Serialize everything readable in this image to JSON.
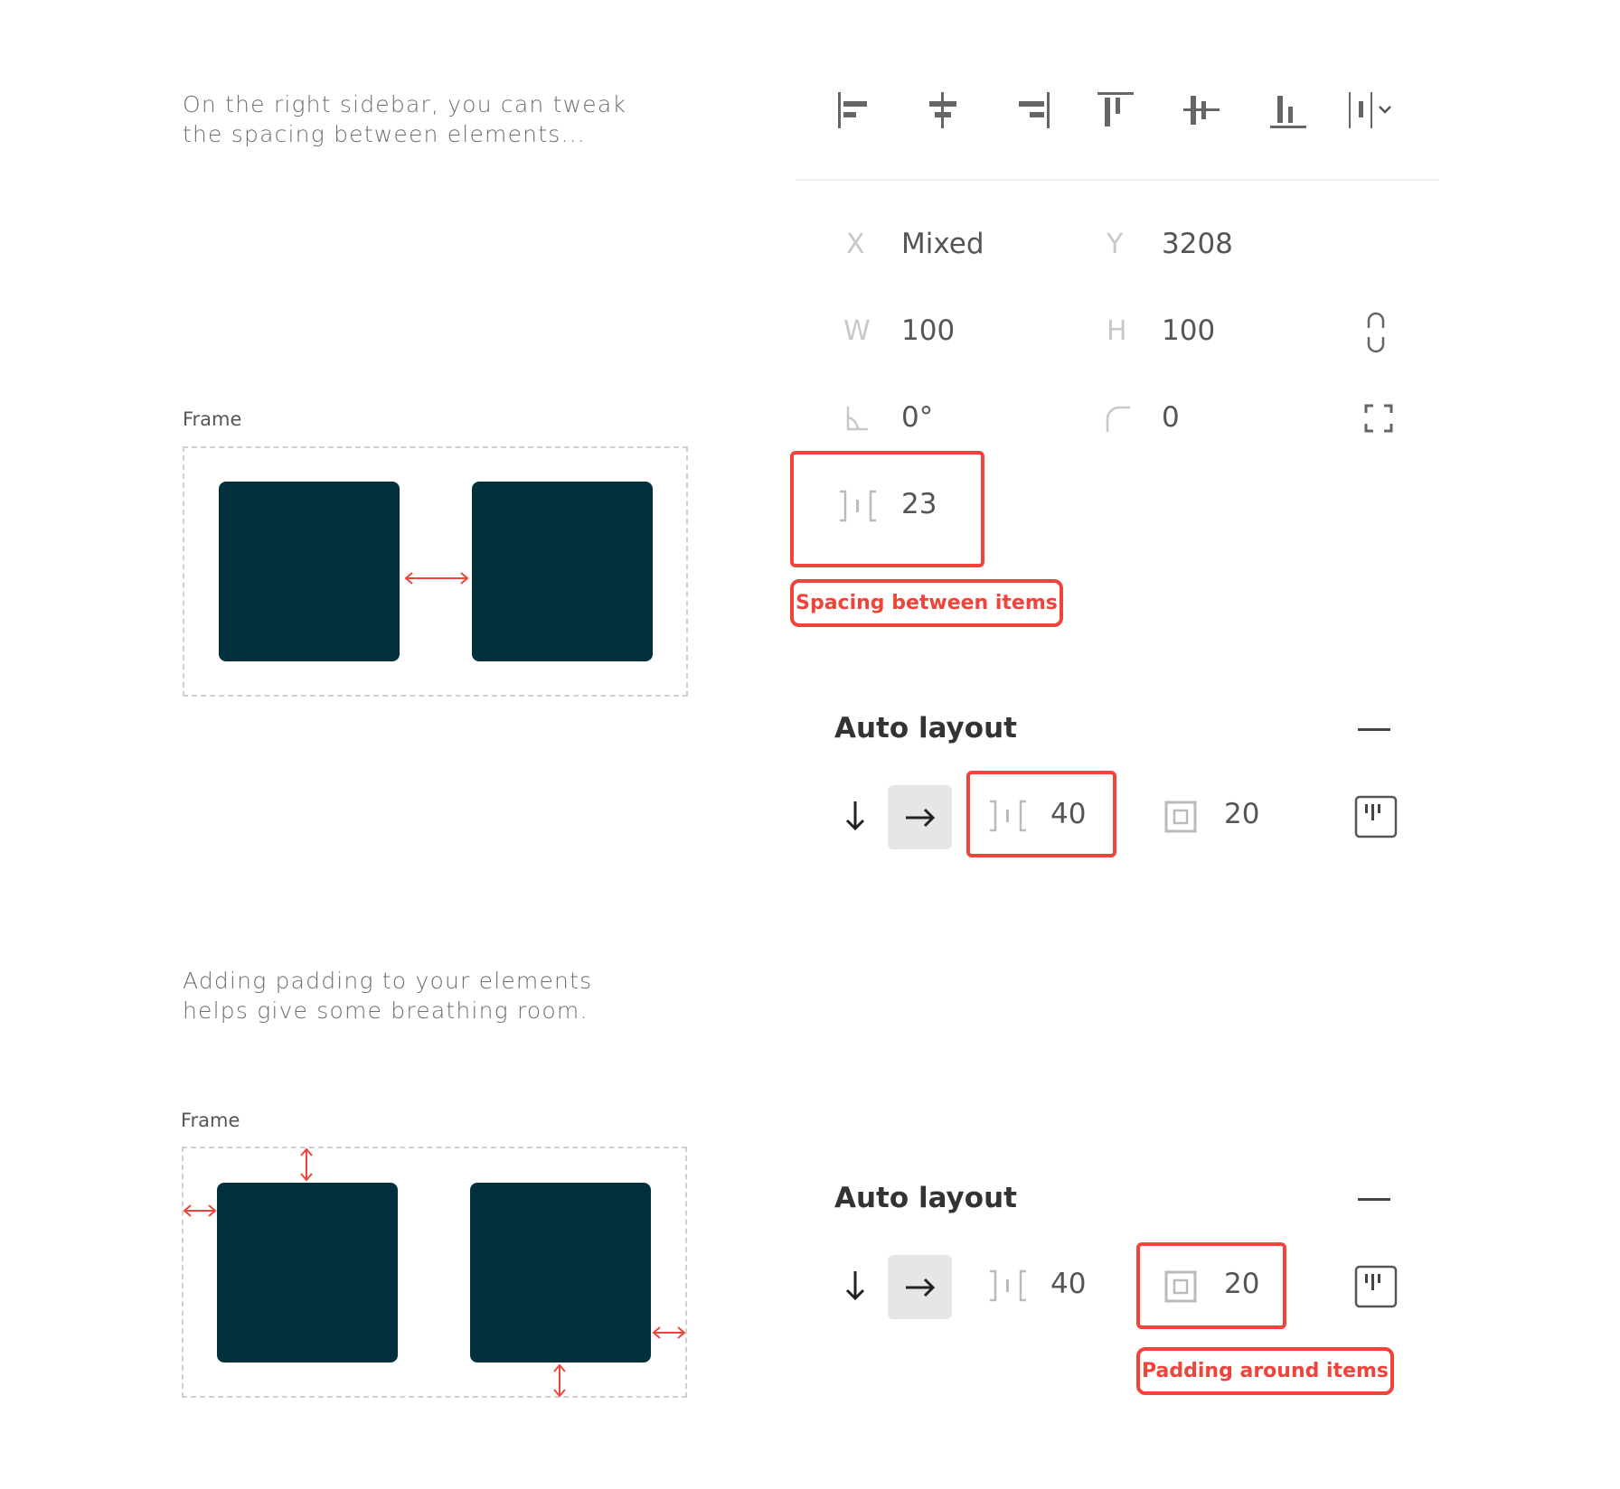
{
  "intro1": {
    "line1": "On the right sidebar, you can tweak",
    "line2": "the spacing between elements..."
  },
  "intro2": {
    "line1": "Adding padding to your elements",
    "line2": "helps give some breathing room."
  },
  "frame1": {
    "label": "Frame"
  },
  "frame2": {
    "label": "Frame"
  },
  "align_toolbar": {
    "icons": [
      "align-left-icon",
      "align-horizontal-center-icon",
      "align-right-icon",
      "align-top-icon",
      "align-vertical-center-icon",
      "align-bottom-icon",
      "distribute-dropdown-icon"
    ]
  },
  "properties": {
    "x_label": "X",
    "x_value": "Mixed",
    "y_label": "Y",
    "y_value": "3208",
    "w_label": "W",
    "w_value": "100",
    "h_label": "H",
    "h_value": "100",
    "rotation_value": "0°",
    "radius_value": "0",
    "spacing_value": "23"
  },
  "annotations": {
    "spacing": "Spacing between items",
    "padding": "Padding around items"
  },
  "auto_layout_1": {
    "title": "Auto layout",
    "spacing": "40",
    "padding": "20",
    "direction": "horizontal"
  },
  "auto_layout_2": {
    "title": "Auto layout",
    "spacing": "40",
    "padding": "20",
    "direction": "horizontal"
  },
  "colors": {
    "accent": "#f0443a",
    "square": "#03303d"
  }
}
